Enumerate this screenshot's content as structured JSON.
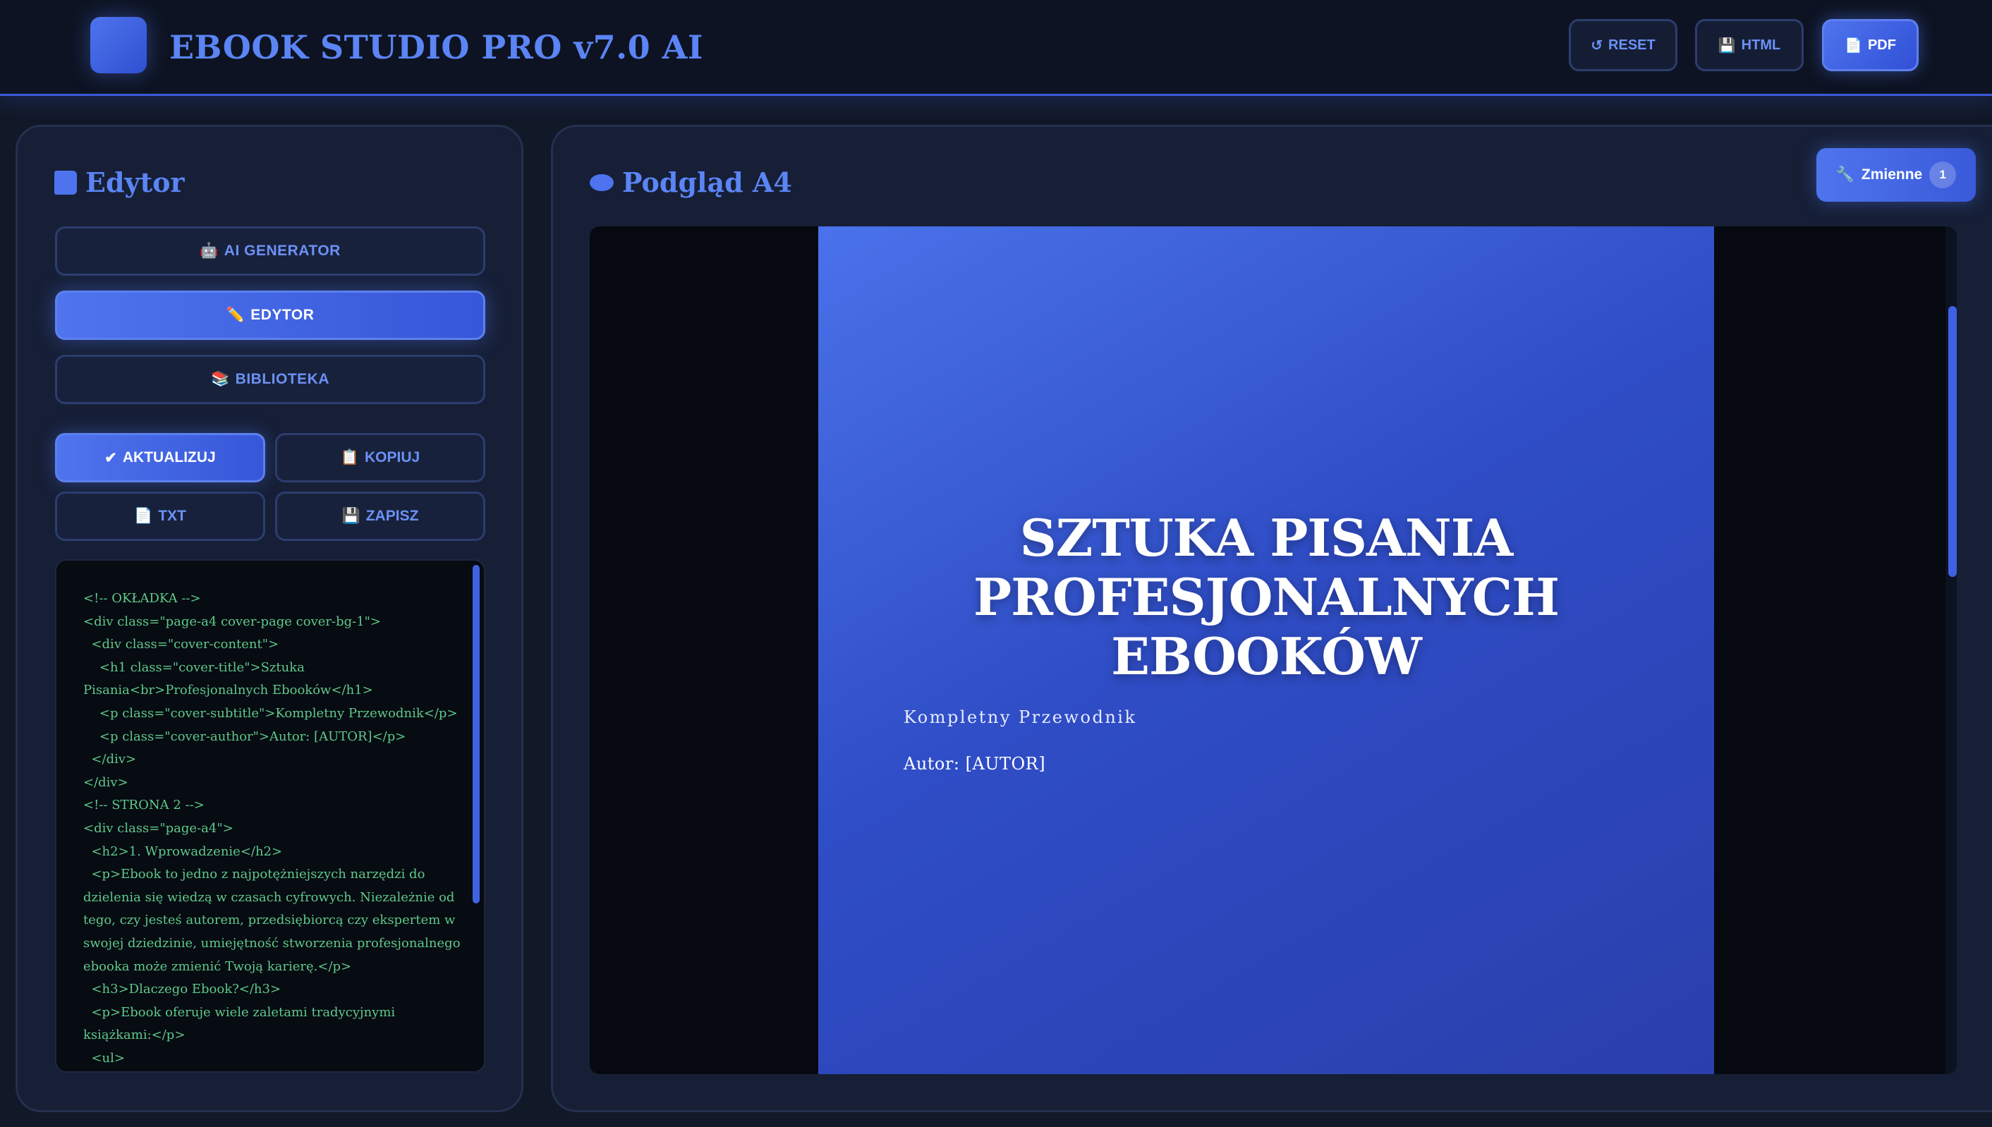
{
  "header": {
    "title": "EBOOK STUDIO PRO v7.0 AI",
    "buttons": {
      "reset": {
        "icon": "↺",
        "label": "RESET"
      },
      "html": {
        "icon": "💾",
        "label": "HTML"
      },
      "pdf": {
        "icon": "📄",
        "label": "PDF"
      }
    }
  },
  "editor": {
    "title": "Edytor",
    "nav": {
      "ai_generator": {
        "icon": "🤖",
        "label": "AI GENERATOR"
      },
      "edytor": {
        "icon": "✏️",
        "label": "EDYTOR"
      },
      "biblioteka": {
        "icon": "📚",
        "label": "BIBLIOTEKA"
      }
    },
    "actions": {
      "aktualizuj": {
        "icon": "✔",
        "label": "AKTUALIZUJ"
      },
      "kopiuj": {
        "icon": "📋",
        "label": "KOPIUJ"
      },
      "txt": {
        "icon": "📄",
        "label": "TXT"
      },
      "zapisz": {
        "icon": "💾",
        "label": "ZAPISZ"
      }
    },
    "code": "<!-- OKŁADKA -->\n<div class=\"page-a4 cover-page cover-bg-1\">\n  <div class=\"cover-content\">\n    <h1 class=\"cover-title\">Sztuka Pisania<br>Profesjonalnych Ebooków</h1>\n    <p class=\"cover-subtitle\">Kompletny Przewodnik</p>\n    <p class=\"cover-author\">Autor: [AUTOR]</p>\n  </div>\n</div>\n<!-- STRONA 2 -->\n<div class=\"page-a4\">\n  <h2>1. Wprowadzenie</h2>\n  <p>Ebook to jedno z najpotężniejszych narzędzi do dzielenia się wiedzą w czasach cyfrowych. Niezależnie od tego, czy jesteś autorem, przedsiębiorcą czy ekspertem w swojej dziedzinie, umiejętność stworzenia profesjonalnego ebooka może zmienić Twoją karierę.</p>\n  <h3>Dlaczego Ebook?</h3>\n  <p>Ebook oferuje wiele zaletami tradycyjnymi książkami:</p>\n  <ul>"
  },
  "preview": {
    "title": "Podgląd A4",
    "changes": {
      "icon": "🔧",
      "label": "Zmienne",
      "count": "1"
    },
    "cover": {
      "title": "SZTUKA PISANIA PROFESJONALNYCH EBOOKÓW",
      "subtitle": "Kompletny Przewodnik",
      "author": "Autor: [AUTOR]"
    }
  },
  "colors": {
    "accent": "#4f74ee",
    "background": "#111827",
    "panel": "#161f36",
    "code_text": "#5fc98a"
  }
}
